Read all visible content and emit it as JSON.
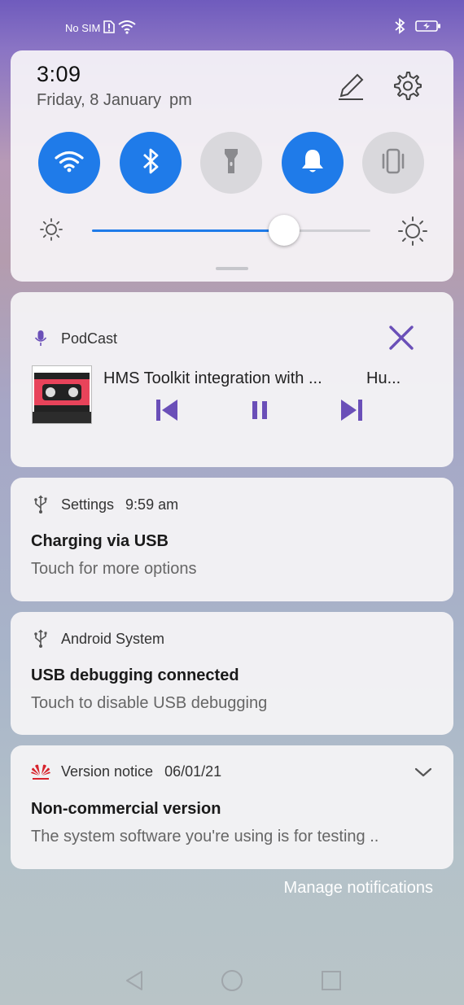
{
  "statusbar": {
    "carrier": "No SIM"
  },
  "quick_settings": {
    "time": "3:09",
    "date": "Friday, 8 January",
    "ampm": "pm",
    "toggles": [
      {
        "name": "wifi",
        "state": "on"
      },
      {
        "name": "bluetooth",
        "state": "on"
      },
      {
        "name": "flashlight",
        "state": "off"
      },
      {
        "name": "sound",
        "state": "on"
      },
      {
        "name": "vibration",
        "state": "off"
      }
    ],
    "brightness_level": 0.69
  },
  "media": {
    "app": "PodCast",
    "title": "HMS Toolkit integration with ...",
    "artist": "Hu...",
    "accent_color": "#6a4fb8"
  },
  "notifications": [
    {
      "app": "Settings",
      "time": "9:59 am",
      "title": "Charging via USB",
      "body": "Touch for more options"
    },
    {
      "app": "Android System",
      "time": "",
      "title": "USB debugging connected",
      "body": "Touch to disable USB debugging"
    },
    {
      "app": "Version notice",
      "time": "06/01/21",
      "title": "Non-commercial version",
      "body": "The system software you're using is for testing .."
    }
  ],
  "manage_label": "Manage notifications",
  "colors": {
    "toggle_on": "#1f7be9",
    "toggle_off": "#d9d8dc"
  }
}
